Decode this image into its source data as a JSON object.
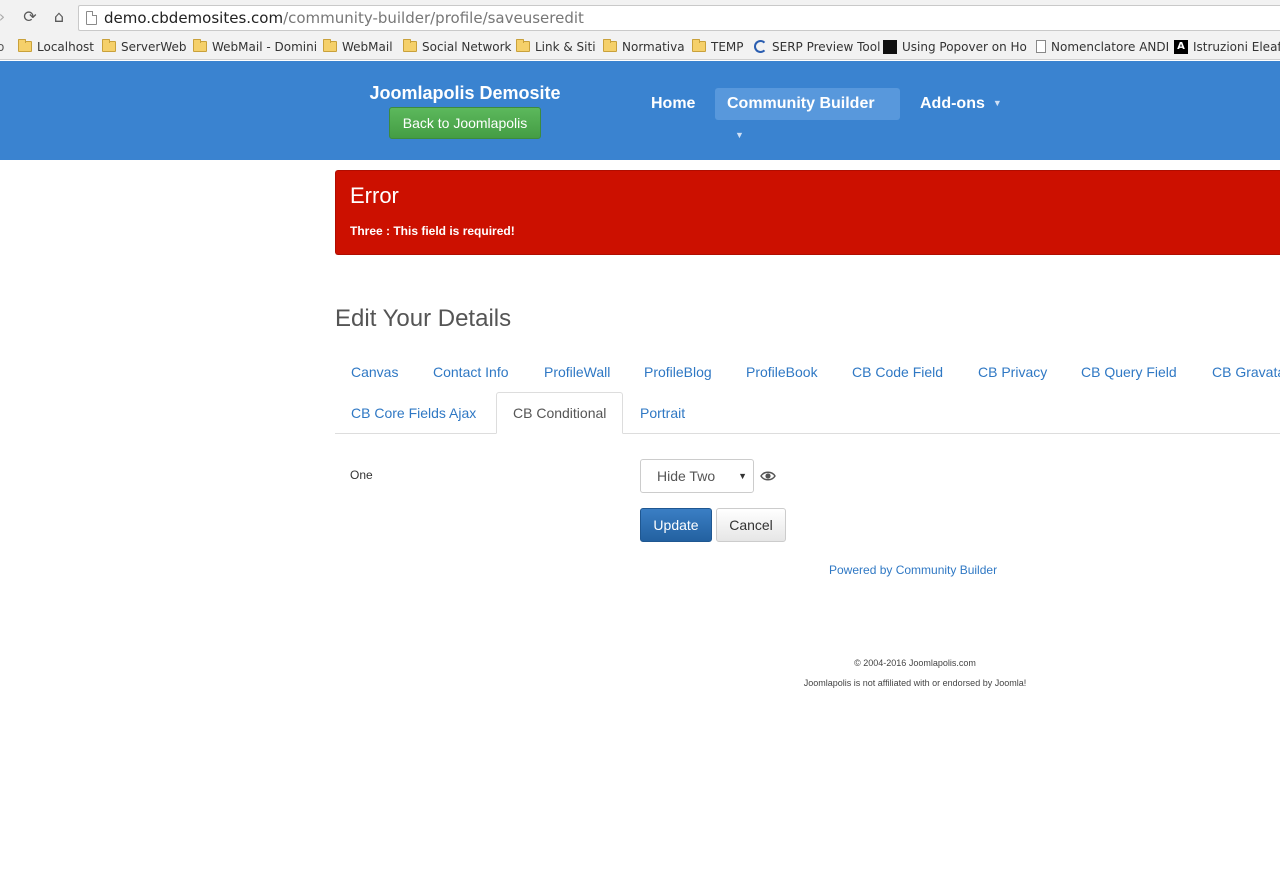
{
  "browser": {
    "url_host": "demo.cbdemosites.com",
    "url_path": "/community-builder/profile/saveuseredit",
    "bookmarks": [
      {
        "label": "Localhost",
        "icon": "folder-icon"
      },
      {
        "label": "ServerWeb",
        "icon": "folder-icon"
      },
      {
        "label": "WebMail - Domini",
        "icon": "folder-icon"
      },
      {
        "label": "WebMail",
        "icon": "folder-icon"
      },
      {
        "label": "Social Network",
        "icon": "folder-icon"
      },
      {
        "label": "Link & Siti",
        "icon": "folder-icon"
      },
      {
        "label": "Normativa",
        "icon": "folder-icon"
      },
      {
        "label": "TEMP",
        "icon": "folder-icon"
      },
      {
        "label": "SERP Preview Tool",
        "icon": "serp-icon"
      },
      {
        "label": "Using Popover on Ho",
        "icon": "site-icon"
      },
      {
        "label": "Nomenclatore ANDI",
        "icon": "page-icon"
      },
      {
        "label": "Istruzioni Eleaf iS",
        "icon": "site-icon"
      }
    ]
  },
  "header": {
    "brand": "Joomlapolis Demosite",
    "back_button": "Back to Joomlapolis",
    "nav": [
      {
        "label": "Home",
        "dropdown": false
      },
      {
        "label": "Community Builder",
        "dropdown": true
      },
      {
        "label": "Add-ons",
        "dropdown": true
      }
    ]
  },
  "alert": {
    "title": "Error",
    "message": "Three : This field is required!"
  },
  "main": {
    "title": "Edit Your Details",
    "tabs_row1": [
      "Canvas",
      "Contact Info",
      "ProfileWall",
      "ProfileBlog",
      "ProfileBook",
      "CB Code Field",
      "CB Privacy",
      "CB Query Field",
      "CB Gravatar"
    ],
    "tabs_row2": [
      "CB Core Fields Ajax",
      "CB Conditional",
      "Portrait"
    ],
    "active_tab": "CB Conditional",
    "field_label": "One",
    "select_value": "Hide Two",
    "update_label": "Update",
    "cancel_label": "Cancel",
    "powered_by": "Powered by Community Builder"
  },
  "footer": {
    "copyright": "© 2004-2016 Joomlapolis.com",
    "disclaimer": "Joomlapolis is not affiliated with or endorsed by Joomla!"
  },
  "colors": {
    "header_bg": "#3a83d0",
    "alert_bg": "#cc1000",
    "link": "#2f78c4",
    "success": "#5cb85c",
    "primary": "#2a6cb0"
  }
}
